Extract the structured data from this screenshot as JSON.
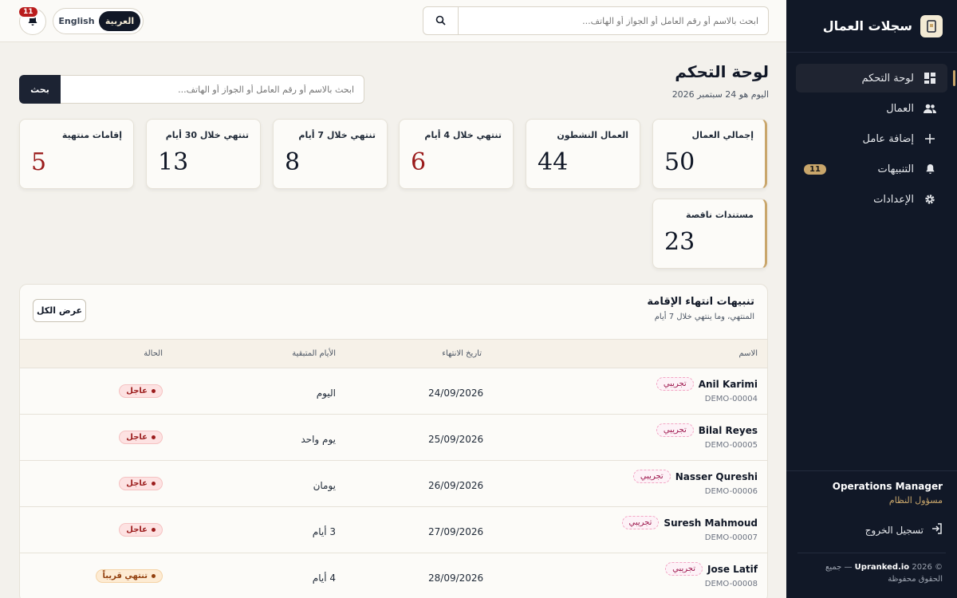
{
  "topbar": {
    "notifications_count": "11",
    "lang_en": "English",
    "lang_ar": "العربية",
    "search_placeholder": "ابحث بالاسم أو رقم العامل أو الجواز أو الهاتف..."
  },
  "sidebar": {
    "brand": "سجلات العمال",
    "items": [
      {
        "label": "لوحة التحكم",
        "icon": "dashboard-icon",
        "active": true
      },
      {
        "label": "العمال",
        "icon": "users-icon"
      },
      {
        "label": "إضافة عامل",
        "icon": "plus-icon"
      },
      {
        "label": "التنبيهات",
        "icon": "bell-icon",
        "badge": "11"
      },
      {
        "label": "الإعدادات",
        "icon": "gear-icon"
      }
    ],
    "user_name": "Operations Manager",
    "user_role": "مسؤول النظام",
    "logout": "تسجيل الخروج",
    "copyright_prefix": "© 2026",
    "copyright_brand": "Upranked.io",
    "copyright_suffix": "— جميع الحقوق محفوظة"
  },
  "page": {
    "title": "لوحة التحكم",
    "subtitle": "اليوم هو 24 سبتمبر 2026",
    "search_placeholder": "ابحث بالاسم أو رقم العامل أو الجواز أو الهاتف...",
    "search_button": "بحث"
  },
  "stats": [
    {
      "label": "إجمالي العمال",
      "value": "50"
    },
    {
      "label": "العمال النشطون",
      "value": "44"
    },
    {
      "label": "تنتهي خلال 4 أيام",
      "value": "6"
    },
    {
      "label": "تنتهي خلال 7 أيام",
      "value": "8"
    },
    {
      "label": "تنتهي خلال 30 أيام",
      "value": "13"
    },
    {
      "label": "إقامات منتهية",
      "value": "5"
    },
    {
      "label": "مستندات ناقصة",
      "value": "23"
    }
  ],
  "alerts": {
    "title": "تنبيهات انتهاء الإقامة",
    "subtitle": "المنتهي، وما ينتهي خلال 7 أيام",
    "view_all": "عرض الكل",
    "columns": {
      "name": "الاسم",
      "expiry": "تاريخ الانتهاء",
      "days": "الأيام المتبقية",
      "status": "الحالة"
    },
    "rows": [
      {
        "name": "Anil Karimi",
        "tag": "تجريبي",
        "code": "DEMO-00004",
        "date": "24/09/2026",
        "days": "اليوم",
        "status": "عاجل"
      },
      {
        "name": "Bilal Reyes",
        "tag": "تجريبي",
        "code": "DEMO-00005",
        "date": "25/09/2026",
        "days": "يوم واحد",
        "status": "عاجل"
      },
      {
        "name": "Nasser Qureshi",
        "tag": "تجريبي",
        "code": "DEMO-00006",
        "date": "26/09/2026",
        "days": "يومان",
        "status": "عاجل"
      },
      {
        "name": "Suresh Mahmoud",
        "tag": "تجريبي",
        "code": "DEMO-00007",
        "date": "27/09/2026",
        "days": "3 أيام",
        "status": "عاجل"
      },
      {
        "name": "Jose Latif",
        "tag": "تجريبي",
        "code": "DEMO-00008",
        "date": "28/09/2026",
        "days": "4 أيام",
        "status": "تنتهي قريباً"
      }
    ]
  },
  "colors": {
    "accent": "#c9a66b",
    "sidebar": "#111827",
    "urgent": "#9b1c1c"
  }
}
